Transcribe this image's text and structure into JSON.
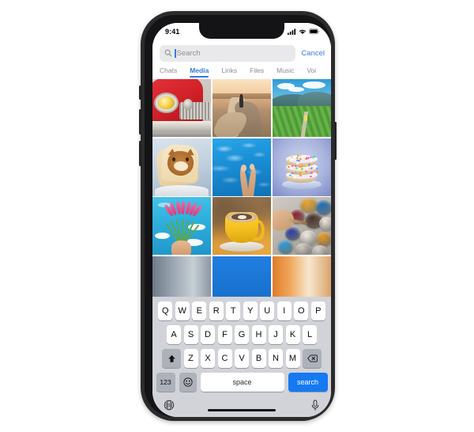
{
  "device": {
    "name": "smartphone-mockup",
    "frame_color": "#2b2b2d"
  },
  "status_bar": {
    "time": "9:41",
    "signal_icon": "cellular-signal-icon",
    "wifi_icon": "wifi-icon",
    "battery_icon": "battery-icon"
  },
  "search": {
    "icon": "search-icon",
    "placeholder": "Search",
    "value": "",
    "cancel_label": "Cancel",
    "accent_color": "#3b7ddd"
  },
  "tabs": {
    "active_index": 1,
    "accent_color": "#2f7ce0",
    "items": [
      {
        "label": "Chats"
      },
      {
        "label": "Media"
      },
      {
        "label": "Links"
      },
      {
        "label": "Files"
      },
      {
        "label": "Music"
      },
      {
        "label": "Voi"
      }
    ]
  },
  "media_grid": {
    "columns": 3,
    "items": [
      {
        "alt": "red-vintage-car"
      },
      {
        "alt": "person-walking-desert-road"
      },
      {
        "alt": "green-mountain-tea-plantation"
      },
      {
        "alt": "cat-face-toast"
      },
      {
        "alt": "legs-in-blue-pool"
      },
      {
        "alt": "stacked-sprinkle-donuts"
      },
      {
        "alt": "hand-holding-pink-flowers"
      },
      {
        "alt": "yellow-cup-latte-art"
      },
      {
        "alt": "paint-buckets"
      },
      {
        "alt": "partial-photo-grey"
      },
      {
        "alt": "partial-photo-blue"
      },
      {
        "alt": "partial-photo-orange"
      }
    ]
  },
  "keyboard": {
    "row1": [
      "Q",
      "W",
      "E",
      "R",
      "T",
      "Y",
      "U",
      "I",
      "O",
      "P"
    ],
    "row2": [
      "A",
      "S",
      "D",
      "F",
      "G",
      "H",
      "J",
      "K",
      "L"
    ],
    "row3_letters": [
      "Z",
      "X",
      "C",
      "V",
      "B",
      "N",
      "M"
    ],
    "shift_icon": "shift-up-arrow-icon",
    "backspace_icon": "backspace-delete-icon",
    "numeric_label": "123",
    "emoji_icon": "emoji-smiley-icon",
    "space_label": "space",
    "search_label": "search",
    "search_key_color": "#1579f2",
    "globe_icon": "globe-language-icon",
    "microphone_icon": "microphone-dictation-icon"
  }
}
